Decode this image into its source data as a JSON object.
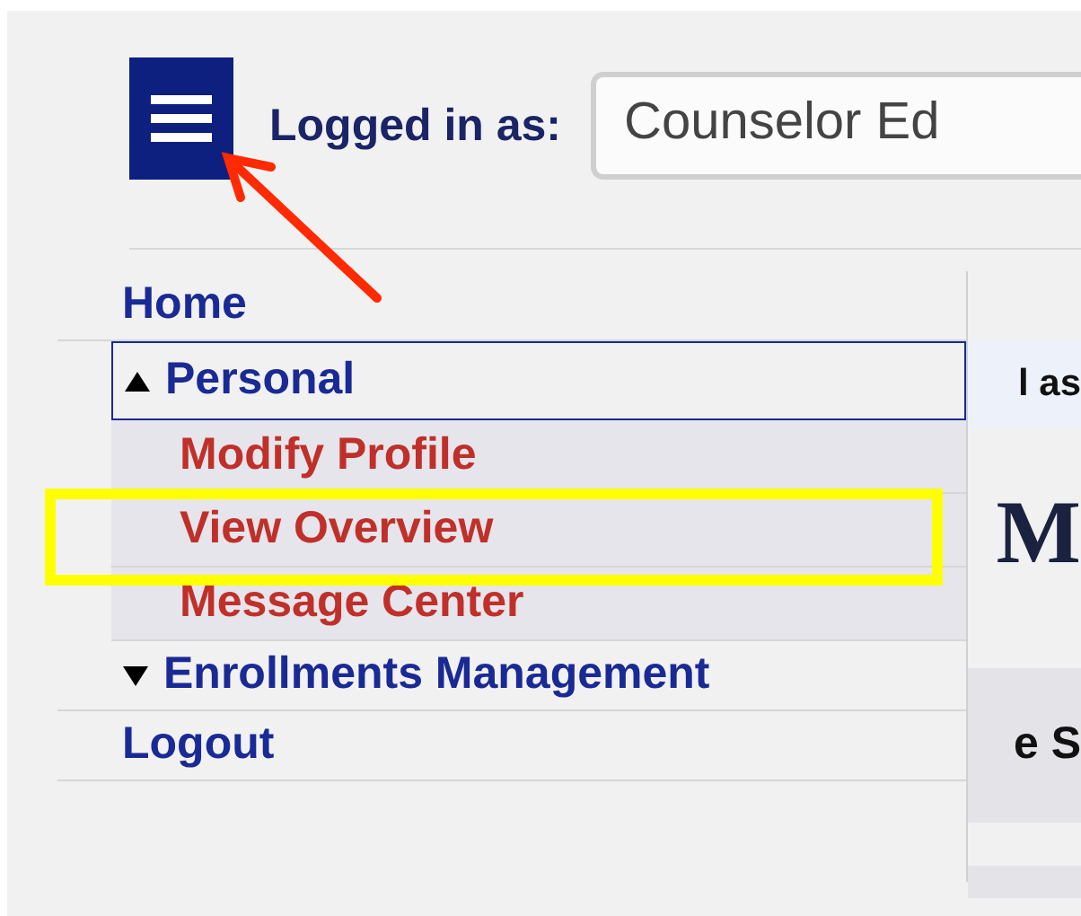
{
  "header": {
    "label": "Logged in as:",
    "user_select": {
      "value": "Counselor Ed"
    }
  },
  "menu": {
    "items": [
      {
        "label": "Home",
        "kind": "link",
        "focused": false
      },
      {
        "label": "Personal",
        "kind": "group",
        "expanded": true,
        "focused": true,
        "children": [
          {
            "label": "Modify Profile"
          },
          {
            "label": "View Overview"
          },
          {
            "label": "Message Center"
          }
        ]
      },
      {
        "label": "Enrollments Management",
        "kind": "group",
        "expanded": false,
        "focused": false
      },
      {
        "label": "Logout",
        "kind": "link",
        "focused": false
      }
    ]
  },
  "background_page": {
    "texts": [
      "l as",
      "M",
      "e S"
    ]
  }
}
